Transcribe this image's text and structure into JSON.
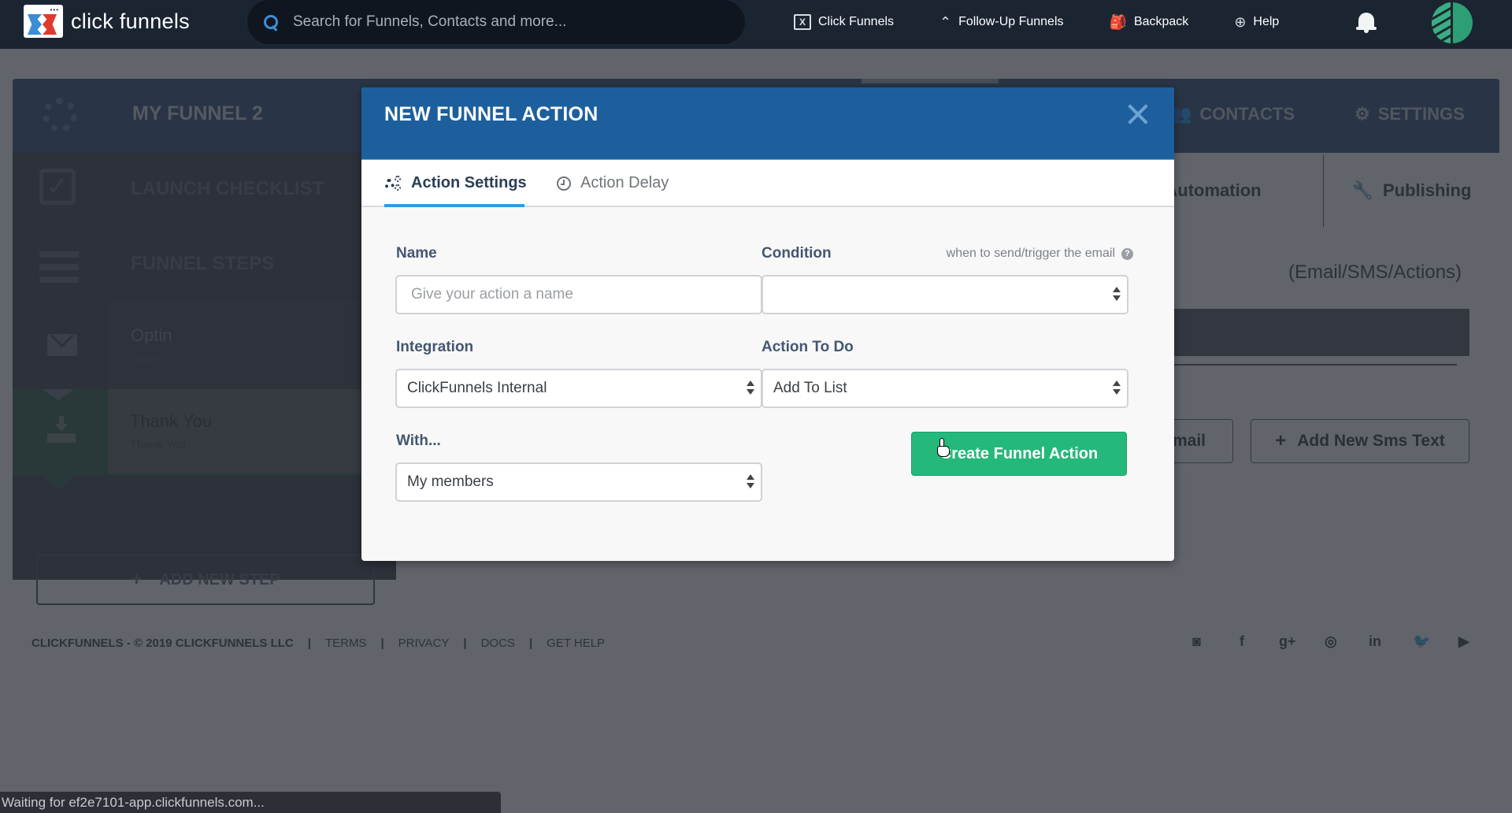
{
  "topnav": {
    "logo_text": "click funnels",
    "search_placeholder": "Search for Funnels, Contacts and more...",
    "links": [
      {
        "label": "Click Funnels",
        "icon": "clickfunnels-icon"
      },
      {
        "label": "Follow-Up Funnels",
        "icon": "double-chevron-up-icon"
      },
      {
        "label": "Backpack",
        "icon": "backpack-icon"
      },
      {
        "label": "Help",
        "icon": "lifebuoy-icon"
      }
    ],
    "notifications_icon": "bell-icon",
    "avatar_icon": "leaf-avatar"
  },
  "funnel": {
    "title": "MY FUNNEL 2",
    "header_tabs": [
      {
        "label": "CONTACTS",
        "icon": "users-icon"
      },
      {
        "label": "SETTINGS",
        "icon": "gear-icon"
      }
    ],
    "sidebar": {
      "launch_checklist": "LAUNCH CHECKLIST",
      "funnel_steps": "FUNNEL STEPS",
      "steps": [
        {
          "name": "Optin",
          "sub": "Optin",
          "icon": "envelope-icon"
        },
        {
          "name": "Thank You",
          "sub": "Thank You",
          "icon": "download-icon",
          "active": true
        }
      ],
      "add_step_label": "ADD NEW STEP"
    },
    "main_tabs": [
      {
        "label": "Automation",
        "icon": "bolt-icon"
      },
      {
        "label": "Publishing",
        "icon": "wrench-icon"
      }
    ],
    "automation_subtitle": "(Email/SMS/Actions)",
    "add_email_label": "Email",
    "add_sms_label": "Add New Sms Text"
  },
  "footer": {
    "copyright": "CLICKFUNNELS - © 2019 CLICKFUNNELS LLC",
    "links": [
      "TERMS",
      "PRIVACY",
      "DOCS",
      "GET HELP"
    ],
    "social": [
      {
        "icon": "rss-icon",
        "glyph": "◙"
      },
      {
        "icon": "facebook-icon",
        "glyph": "f"
      },
      {
        "icon": "google-plus-icon",
        "glyph": "g+"
      },
      {
        "icon": "instagram-icon",
        "glyph": "◎"
      },
      {
        "icon": "linkedin-icon",
        "glyph": "in"
      },
      {
        "icon": "twitter-icon",
        "glyph": "🐦"
      },
      {
        "icon": "youtube-icon",
        "glyph": "▶"
      }
    ]
  },
  "modal": {
    "title": "NEW FUNNEL ACTION",
    "tabs": [
      {
        "label": "Action Settings",
        "active": true
      },
      {
        "label": "Action Delay",
        "active": false
      }
    ],
    "fields": {
      "name": {
        "label": "Name",
        "placeholder": "Give your action a name",
        "value": ""
      },
      "condition": {
        "label": "Condition",
        "hint": "when to send/trigger the email",
        "value": ""
      },
      "integration": {
        "label": "Integration",
        "value": "ClickFunnels Internal"
      },
      "action_to_do": {
        "label": "Action To Do",
        "value": "Add To List"
      },
      "with": {
        "label": "With...",
        "value": "My members"
      }
    },
    "submit_label": "Create Funnel Action"
  },
  "statusbar": {
    "text": "Waiting for ef2e7101-app.clickfunnels.com..."
  },
  "colors": {
    "brand_blue": "#1d5f9c",
    "accent_green": "#24b97a",
    "tab_underline": "#2f9be0",
    "nav_bg": "#1b2532"
  }
}
